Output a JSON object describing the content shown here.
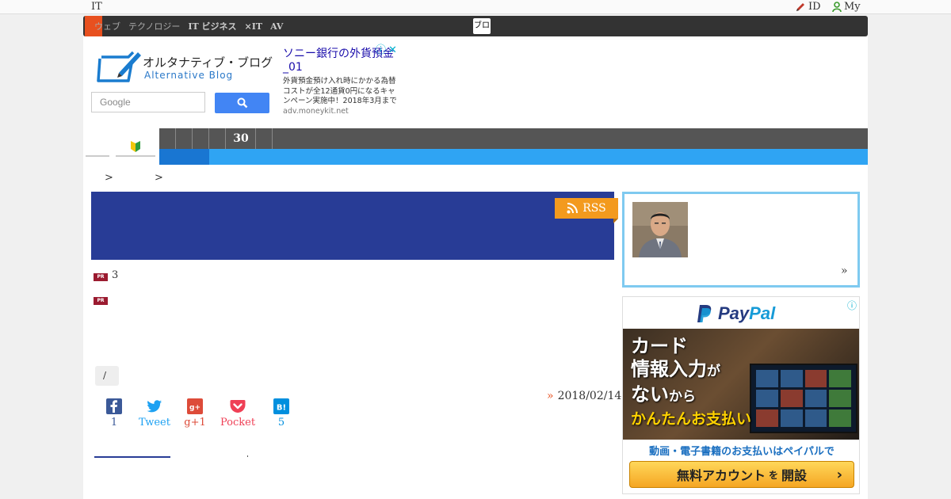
{
  "topbar": {
    "left_label": "IT",
    "id_label": "ID",
    "my_label": "My"
  },
  "darknav": {
    "items": [
      "ウェブ",
      "テクノロジー",
      "IT ビジネス",
      "×IT",
      "AV"
    ],
    "bold_items": [
      "IT",
      "×IT",
      "AV"
    ],
    "active_label": "ブログ"
  },
  "logo": {
    "jp": "オルタナティブ・ブログ",
    "en": "Alternative Blog"
  },
  "search": {
    "placeholder": "Google"
  },
  "textad": {
    "title": "ソニー銀行の外貨預金_01",
    "desc": "外貨預金預け入れ時にかかる為替コストが全12通貨0円になるキャンペーン実施中！2018年3月まで",
    "url": "adv.moneykit.net"
  },
  "mainnav": {
    "number_label": "30"
  },
  "breadcrumb": {
    "sep1": ">",
    "sep2": ">"
  },
  "rss": {
    "label": "RSS"
  },
  "pr": {
    "badge": "PR",
    "text1": "3"
  },
  "slash": {
    "label": "/"
  },
  "post": {
    "date_marker": "»",
    "date": "2018/02/14"
  },
  "share": {
    "facebook": {
      "count": "1"
    },
    "twitter": {
      "label": "Tweet"
    },
    "gplus": {
      "label": "g+1"
    },
    "pocket": {
      "label": "Pocket"
    },
    "hatena": {
      "count": "5"
    }
  },
  "sidebar": {
    "more": "»"
  },
  "paypal_ad": {
    "brand_pre": "Pay",
    "brand_post": "Pal",
    "line1": "カード",
    "line2a": "情報入力",
    "line2b": "が",
    "line3a": "ない",
    "line3b": "から",
    "line4": "かんたんお支払い",
    "sub": "動画・電子書籍のお支払いはペイパルで",
    "cta_a": "無料アカウント",
    "cta_b": "を",
    "cta_c": "開設",
    "cta_arrow": "›",
    "info": "ⓘ"
  },
  "colors": {
    "accent_orange": "#e8501f",
    "header_blue": "#283c96",
    "nav_blue": "#2fa4f3",
    "rss_orange": "#f39a1e"
  }
}
